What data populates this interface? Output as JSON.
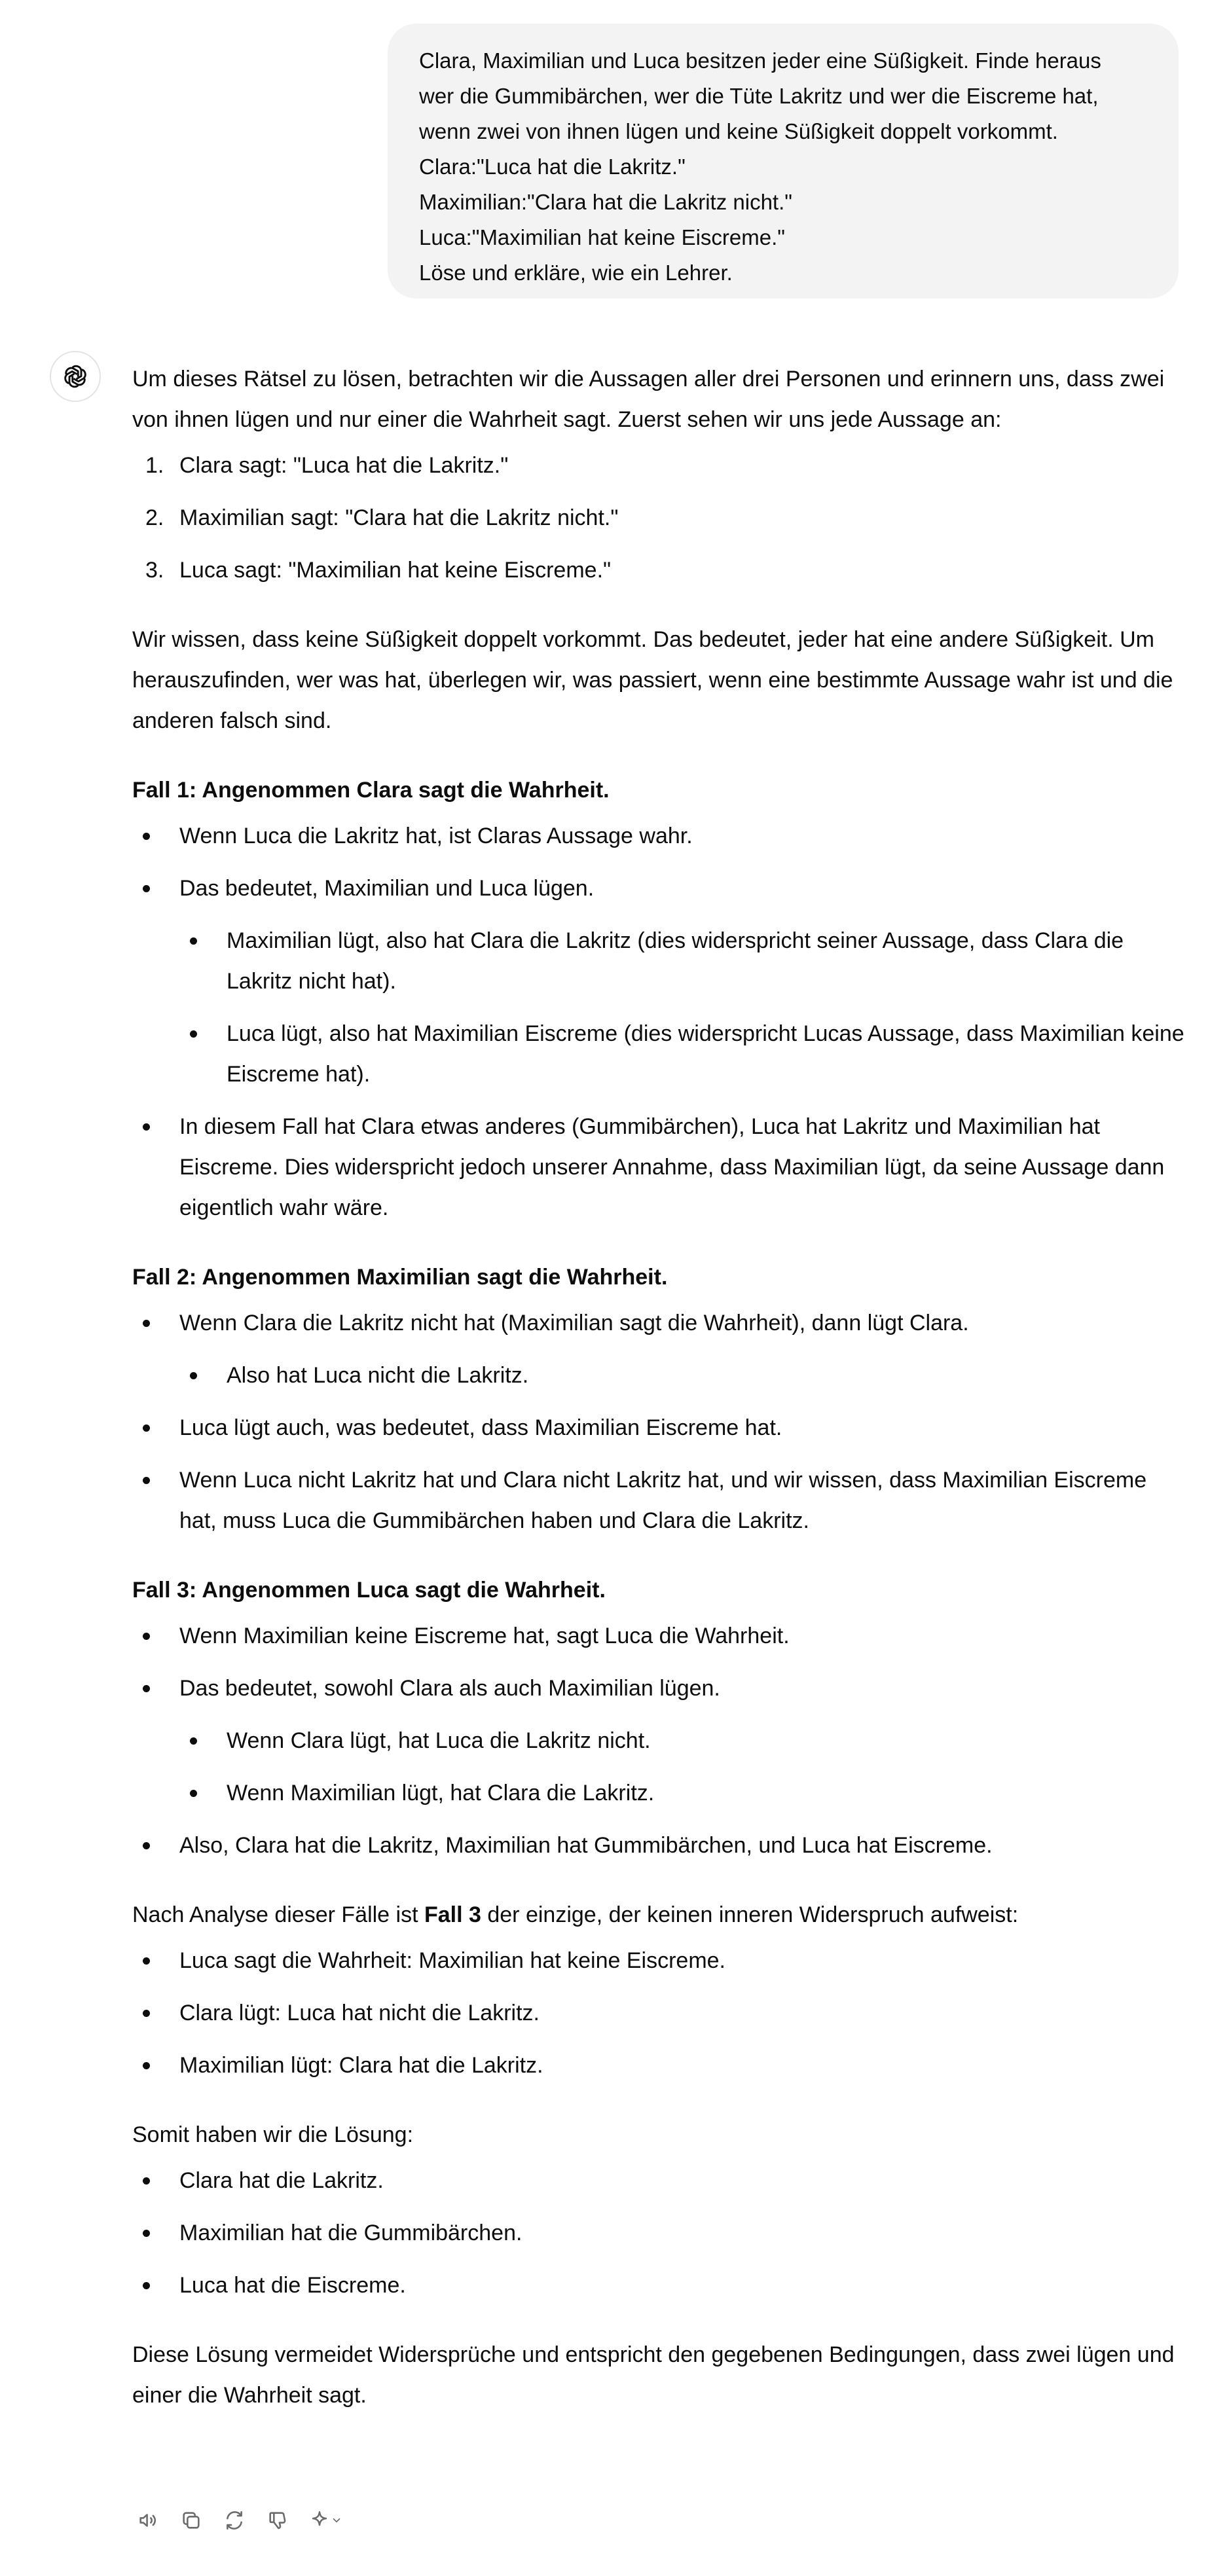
{
  "user_message": {
    "lines": [
      "Clara, Maximilian und Luca besitzen jeder eine Süßigkeit. Finde heraus",
      "wer die Gummibärchen, wer die Tüte Lakritz und wer die Eiscreme hat,",
      "wenn zwei von ihnen lügen und keine Süßigkeit doppelt vorkommt.",
      "Clara:\"Luca hat die Lakritz.\"",
      "Maximilian:\"Clara hat die Lakritz nicht.\"",
      "Luca:\"Maximilian hat keine Eiscreme.\"",
      "Löse und erkläre, wie ein Lehrer."
    ]
  },
  "assistant": {
    "avatar_icon": "openai-logo-icon",
    "intro": "Um dieses Rätsel zu lösen, betrachten wir die Aussagen aller drei Personen und erinnern uns, dass zwei von ihnen lügen und nur einer die Wahrheit sagt. Zuerst sehen wir uns jede Aussage an:",
    "statements": [
      {
        "marker": "1.",
        "text": "Clara sagt: \"Luca hat die Lakritz.\""
      },
      {
        "marker": "2.",
        "text": "Maximilian sagt: \"Clara hat die Lakritz nicht.\""
      },
      {
        "marker": "3.",
        "text": "Luca sagt: \"Maximilian hat keine Eiscreme.\""
      }
    ],
    "reasoning_intro": "Wir wissen, dass keine Süßigkeit doppelt vorkommt. Das bedeutet, jeder hat eine andere Süßigkeit. Um herauszufinden, wer was hat, überlegen wir, was passiert, wenn eine bestimmte Aussage wahr ist und die anderen falsch sind.",
    "case1": {
      "heading": "Fall 1: Angenommen Clara sagt die Wahrheit.",
      "b1": "Wenn Luca die Lakritz hat, ist Claras Aussage wahr.",
      "b2": "Das bedeutet, Maximilian und Luca lügen.",
      "b2_sub1": "Maximilian lügt, also hat Clara die Lakritz (dies widerspricht seiner Aussage, dass Clara die Lakritz nicht hat).",
      "b2_sub2": "Luca lügt, also hat Maximilian Eiscreme (dies widerspricht Lucas Aussage, dass Maximilian keine Eiscreme hat).",
      "b3": "In diesem Fall hat Clara etwas anderes (Gummibärchen), Luca hat Lakritz und Maximilian hat Eiscreme. Dies widerspricht jedoch unserer Annahme, dass Maximilian lügt, da seine Aussage dann eigentlich wahr wäre."
    },
    "case2": {
      "heading": "Fall 2: Angenommen Maximilian sagt die Wahrheit.",
      "b1": "Wenn Clara die Lakritz nicht hat (Maximilian sagt die Wahrheit), dann lügt Clara.",
      "b1_sub1": "Also hat Luca nicht die Lakritz.",
      "b2": "Luca lügt auch, was bedeutet, dass Maximilian Eiscreme hat.",
      "b3": "Wenn Luca nicht Lakritz hat und Clara nicht Lakritz hat, und wir wissen, dass Maximilian Eiscreme hat, muss Luca die Gummibärchen haben und Clara die Lakritz."
    },
    "case3": {
      "heading": "Fall 3: Angenommen Luca sagt die Wahrheit.",
      "b1": "Wenn Maximilian keine Eiscreme hat, sagt Luca die Wahrheit.",
      "b2": "Das bedeutet, sowohl Clara als auch Maximilian lügen.",
      "b2_sub1": "Wenn Clara lügt, hat Luca die Lakritz nicht.",
      "b2_sub2": "Wenn Maximilian lügt, hat Clara die Lakritz.",
      "b3": "Also, Clara hat die Lakritz, Maximilian hat Gummibärchen, und Luca hat Eiscreme."
    },
    "analysis": {
      "before": "Nach Analyse dieser Fälle ist ",
      "bold": "Fall 3",
      "after": " der einzige, der keinen inneren Widerspruch aufweist:",
      "items": [
        "Luca sagt die Wahrheit: Maximilian hat keine Eiscreme.",
        "Clara lügt: Luca hat nicht die Lakritz.",
        "Maximilian lügt: Clara hat die Lakritz."
      ]
    },
    "solution": {
      "intro": "Somit haben wir die Lösung:",
      "items": [
        "Clara hat die Lakritz.",
        "Maximilian hat die Gummibärchen.",
        "Luca hat die Eiscreme."
      ]
    },
    "conclusion": "Diese Lösung vermeidet Widersprüche und entspricht den gegebenen Bedingungen, dass zwei lügen und einer die Wahrheit sagt."
  },
  "actions": [
    {
      "name": "read-aloud-button",
      "icon": "speaker-icon"
    },
    {
      "name": "copy-button",
      "icon": "copy-icon"
    },
    {
      "name": "regenerate-button",
      "icon": "refresh-icon"
    },
    {
      "name": "thumbs-down-button",
      "icon": "thumbs-down-icon"
    },
    {
      "name": "model-switch-button",
      "icon": "sparkle-icon"
    }
  ],
  "colors": {
    "bubble_background": "#f3f3f3",
    "text": "#0d0d0d",
    "icon": "#6b6b6b"
  }
}
